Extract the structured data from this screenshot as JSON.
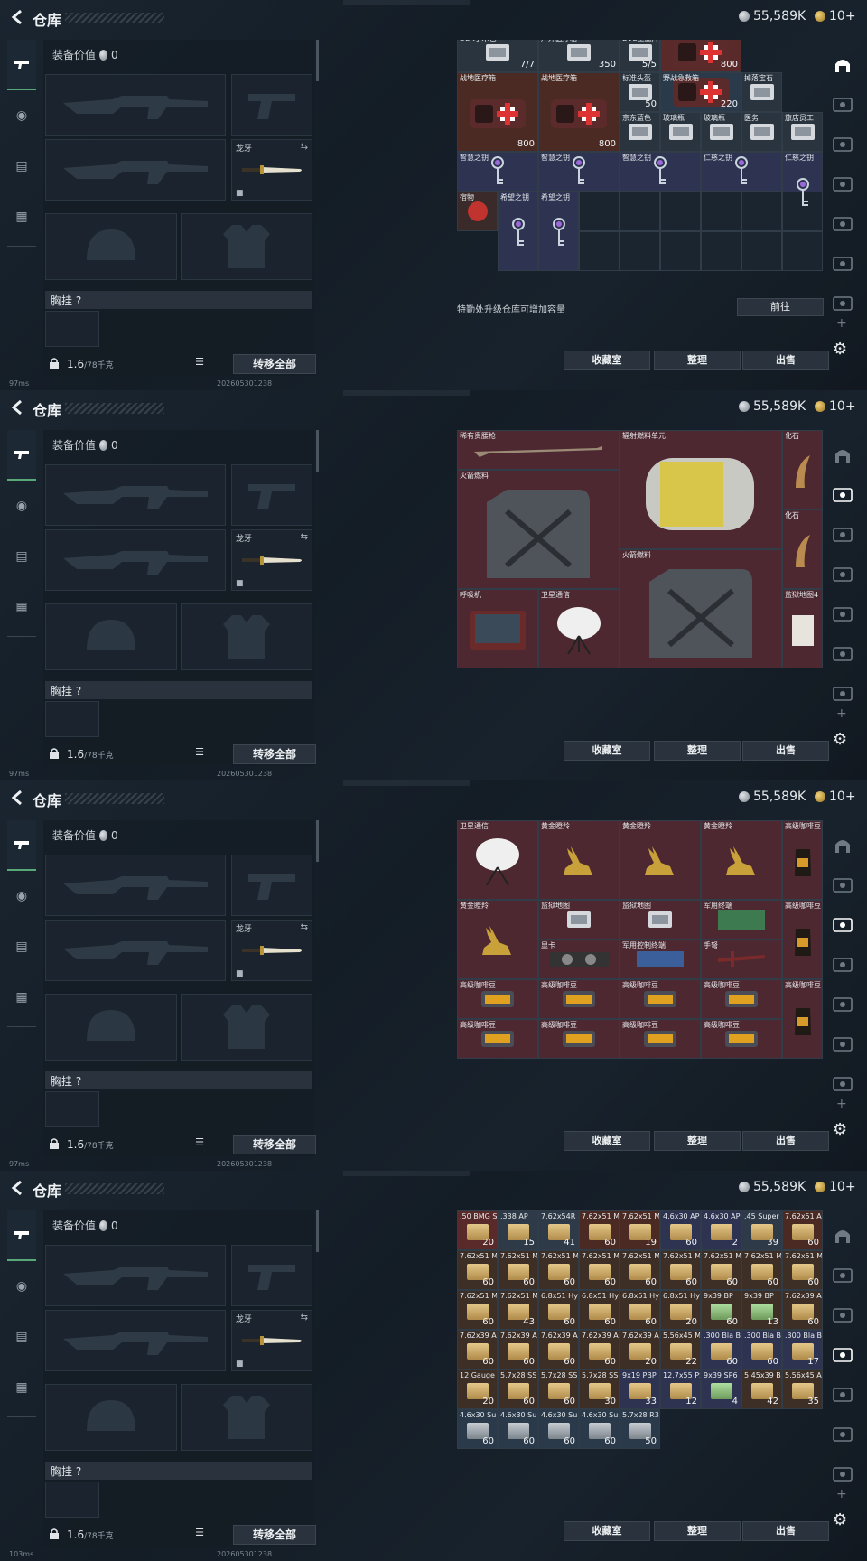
{
  "header": {
    "title": "仓库",
    "silver": "55,589K",
    "gold": "10+"
  },
  "loadout": {
    "title": "装备价值",
    "value": "0",
    "knife_name": "龙牙",
    "chest_label": "胸挂 ?",
    "weight": "1.6",
    "weight_max": "/78千克",
    "transfer_label": "转移全部"
  },
  "footer": {
    "collection": "收藏室",
    "sort": "整理",
    "sell": "出售",
    "upgrade_note": "特勤处升级仓库可增加容量",
    "goto": "前往"
  },
  "statusbars": [
    "97ms",
    "97ms",
    "97ms",
    "103ms"
  ],
  "timestamps": [
    "202605301238",
    "202605301238",
    "202605301238",
    "202605301238"
  ],
  "icons": {
    "back": "back-arrow-icon",
    "lock": "lock-icon",
    "list": "list-icon",
    "gear": "gear-icon",
    "plus": "plus-icon"
  },
  "panels": [
    {
      "active_tab": 0,
      "show_note": true,
      "cells": [
        {
          "n": "DEK手术包",
          "q": "7/7"
        },
        {
          "n": "户外医疗箱",
          "q": "350"
        },
        {
          "n": "DVE止血片",
          "q": "5/5"
        },
        {
          "n": "",
          "q": "800"
        },
        {
          "n": "战地医疗箱",
          "q": "800"
        },
        {
          "n": "战地医疗箱",
          "q": "800"
        },
        {
          "n": "标准头盔",
          "q": "50"
        },
        {
          "n": "野战急救箱",
          "q": "220"
        },
        {
          "n": "掉落宝石",
          "q": ""
        },
        {
          "n": "京东蓝色",
          "q": ""
        },
        {
          "n": "玻璃瓶",
          "q": ""
        },
        {
          "n": "玻璃瓶",
          "q": ""
        },
        {
          "n": "医务",
          "q": ""
        },
        {
          "n": "旅店员工",
          "q": ""
        },
        {
          "n": "智慧之钥",
          "q": ""
        },
        {
          "n": "智慧之钥",
          "q": ""
        },
        {
          "n": "智慧之钥",
          "q": ""
        },
        {
          "n": "仁慈之钥",
          "q": ""
        },
        {
          "n": "仁慈之钥",
          "q": ""
        },
        {
          "n": "宿物",
          "q": ""
        },
        {
          "n": "希望之钥",
          "q": ""
        },
        {
          "n": "希望之钥",
          "q": ""
        }
      ]
    },
    {
      "active_tab": 1,
      "show_note": false,
      "cells": [
        {
          "n": "稀有贵腰枪",
          "q": ""
        },
        {
          "n": "辐射燃料单元",
          "q": ""
        },
        {
          "n": "化石",
          "q": ""
        },
        {
          "n": "火箭燃料",
          "q": ""
        },
        {
          "n": "化石",
          "q": ""
        },
        {
          "n": "火箭燃料",
          "q": ""
        },
        {
          "n": "呼吸机",
          "q": ""
        },
        {
          "n": "卫星通信",
          "q": ""
        },
        {
          "n": "监狱地图4",
          "q": ""
        }
      ]
    },
    {
      "active_tab": 2,
      "show_note": false,
      "cells": [
        {
          "n": "卫星通信",
          "q": ""
        },
        {
          "n": "黄金瞪羚",
          "q": ""
        },
        {
          "n": "黄金瞪羚",
          "q": ""
        },
        {
          "n": "黄金瞪羚",
          "q": ""
        },
        {
          "n": "高级咖啡豆",
          "q": ""
        },
        {
          "n": "黄金瞪羚",
          "q": ""
        },
        {
          "n": "监狱地图",
          "q": ""
        },
        {
          "n": "监狱地图",
          "q": ""
        },
        {
          "n": "军用终端",
          "q": ""
        },
        {
          "n": "高级咖啡豆",
          "q": ""
        },
        {
          "n": "显卡",
          "q": ""
        },
        {
          "n": "军用控制终端",
          "q": ""
        },
        {
          "n": "手弩",
          "q": ""
        },
        {
          "n": "高级咖啡豆",
          "q": ""
        },
        {
          "n": "高级咖啡豆",
          "q": ""
        },
        {
          "n": "高级咖啡豆",
          "q": ""
        },
        {
          "n": "高级咖啡豆",
          "q": ""
        },
        {
          "n": "高级咖啡豆",
          "q": ""
        },
        {
          "n": "高级咖啡豆",
          "q": ""
        },
        {
          "n": "高级咖啡豆",
          "q": ""
        },
        {
          "n": "高级咖啡豆",
          "q": ""
        },
        {
          "n": "高级咖啡豆",
          "q": ""
        }
      ]
    },
    {
      "active_tab": 3,
      "show_note": false,
      "cells": [
        {
          "n": ".50 BMG SLAP",
          "q": "20"
        },
        {
          "n": ".338 AP",
          "q": "15"
        },
        {
          "n": "7.62x54R SNB",
          "q": "41"
        },
        {
          "n": "7.62x51 M61",
          "q": "60"
        },
        {
          "n": "7.62x51 M62",
          "q": "19"
        },
        {
          "n": "4.6x30 AP",
          "q": "60"
        },
        {
          "n": "4.6x30 AP",
          "q": "2"
        },
        {
          "n": ".45 Super",
          "q": "39"
        },
        {
          "n": "7.62x51 AP",
          "q": "60"
        },
        {
          "n": "7.62x51 M80",
          "q": "60"
        },
        {
          "n": "7.62x51 M80",
          "q": "60"
        },
        {
          "n": "7.62x51 M80",
          "q": "60"
        },
        {
          "n": "7.62x51 M80",
          "q": "60"
        },
        {
          "n": "7.62x51 M80",
          "q": "60"
        },
        {
          "n": "7.62x51 M80",
          "q": "60"
        },
        {
          "n": "7.62x51 M80",
          "q": "60"
        },
        {
          "n": "7.62x51 M80",
          "q": "60"
        },
        {
          "n": "7.62x51 M80",
          "q": "60"
        },
        {
          "n": "7.62x51 M80",
          "q": "60"
        },
        {
          "n": "7.62x51 M80",
          "q": "43"
        },
        {
          "n": "6.8x51 Hybrid",
          "q": "60"
        },
        {
          "n": "6.8x51 Hybrid",
          "q": "60"
        },
        {
          "n": "6.8x51 Hybrid",
          "q": "60"
        },
        {
          "n": "6.8x51 Hybrid",
          "q": "20"
        },
        {
          "n": "9x39 BP",
          "q": "60"
        },
        {
          "n": "9x39 BP",
          "q": "13"
        },
        {
          "n": "7.62x39 AP",
          "q": "60"
        },
        {
          "n": "7.62x39 AP",
          "q": "60"
        },
        {
          "n": "7.62x39 AP",
          "q": "60"
        },
        {
          "n": "7.62x39 AP",
          "q": "60"
        },
        {
          "n": "7.62x39 AP",
          "q": "60"
        },
        {
          "n": "7.62x39 AP",
          "q": "20"
        },
        {
          "n": "5.56x45 M995",
          "q": "22"
        },
        {
          "n": ".300 Bla BPZ",
          "q": "60"
        },
        {
          "n": ".300 Bla BPZ",
          "q": "60"
        },
        {
          "n": ".300 Bla BPZ",
          "q": "17"
        },
        {
          "n": "12 Gauge Slug",
          "q": "20"
        },
        {
          "n": "5.7x28 SS190",
          "q": "60"
        },
        {
          "n": "5.7x28 SS190",
          "q": "60"
        },
        {
          "n": "5.7x28 SS190",
          "q": "30"
        },
        {
          "n": "9x19 PBP",
          "q": "33"
        },
        {
          "n": "12.7x55 PS12B",
          "q": "12"
        },
        {
          "n": "9x39 SP6",
          "q": "4"
        },
        {
          "n": "5.45x39 BS",
          "q": "42"
        },
        {
          "n": "5.56x45 AP",
          "q": "35"
        },
        {
          "n": "4.6x30 Subsonic",
          "q": "60"
        },
        {
          "n": "4.6x30 Subsonic",
          "q": "60"
        },
        {
          "n": "4.6x30 Subsonic",
          "q": "60"
        },
        {
          "n": "4.6x30 Subsonic",
          "q": "60"
        },
        {
          "n": "5.7x28 R37",
          "q": "50"
        }
      ]
    }
  ]
}
